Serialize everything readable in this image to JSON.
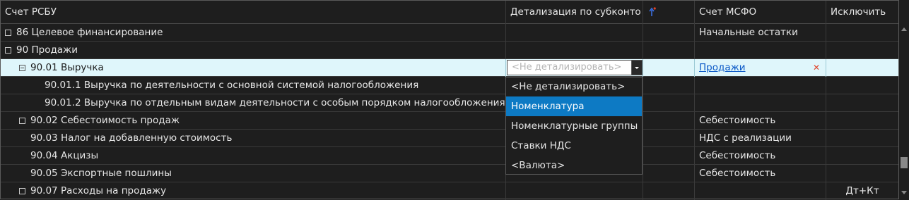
{
  "columns": {
    "account_rsbu": "Счет РСБУ",
    "detail_by_subconto": "Детализация по субконто",
    "sort_icon": "sort-arrow-icon",
    "account_msfo": "Счет МСФО",
    "exclude": "Исключить"
  },
  "rows": [
    {
      "label": "86 Целевое финансирование",
      "msfo": "Начальные остатки",
      "exclude": ""
    },
    {
      "label": "90 Продажи",
      "msfo": "",
      "exclude": ""
    },
    {
      "label": "90.01 Выручка",
      "detail": "<Не детализировать>",
      "msfo": "Продажи",
      "exclude": ""
    },
    {
      "label": "90.01.1 Выручка по деятельности с основной системой налогообложения",
      "msfo": "",
      "exclude": ""
    },
    {
      "label": "90.01.2 Выручка по отдельным видам деятельности с особым порядком налогообложения",
      "msfo": "",
      "exclude": ""
    },
    {
      "label": "90.02 Себестоимость продаж",
      "msfo": "Себестоимость",
      "exclude": ""
    },
    {
      "label": "90.03 Налог на добавленную стоимость",
      "msfo": "НДС с реализации",
      "exclude": ""
    },
    {
      "label": "90.04 Акцизы",
      "msfo": "Себестоимость",
      "exclude": ""
    },
    {
      "label": "90.05 Экспортные пошлины",
      "msfo": "Себестоимость",
      "exclude": ""
    },
    {
      "label": "90.07 Расходы на продажу",
      "msfo": "",
      "exclude": "Дт+Кт"
    }
  ],
  "dropdown": {
    "items": [
      "<Не детализировать>",
      "Номенклатура",
      "Номенклатурные группы",
      "Ставки НДС",
      "<Валюта>"
    ],
    "active_index": 1
  },
  "colors": {
    "background": "#1e1e1e",
    "selected_row": "#dff6fb",
    "dropdown_active": "#0d7ac4",
    "link": "#0a58c7",
    "clear_icon": "#e0452b"
  }
}
